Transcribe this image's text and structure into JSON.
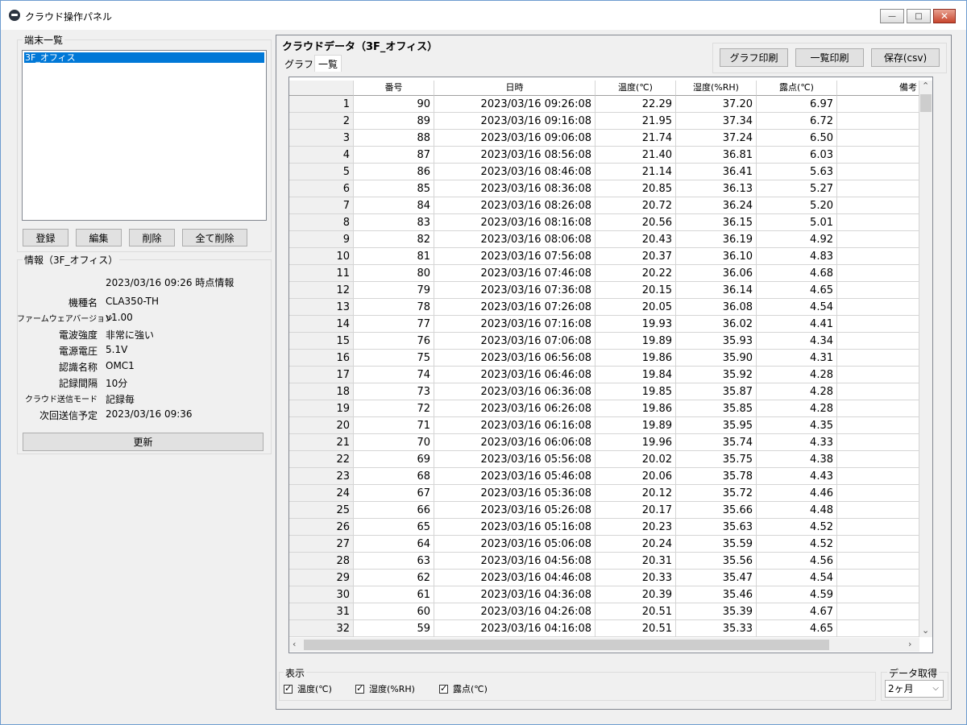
{
  "window": {
    "title": "クラウド操作パネル",
    "minimize": "—",
    "maximize": "□",
    "close": "✕"
  },
  "devices": {
    "group_label": "端末一覧",
    "items": [
      "3F_オフィス"
    ],
    "selected_index": 0,
    "buttons": {
      "register": "登録",
      "edit": "編集",
      "delete": "削除",
      "delete_all": "全て削除"
    }
  },
  "info": {
    "group_label": "情報（3F_オフィス）",
    "timestamp": "2023/03/16 09:26 時点情報",
    "rows": [
      {
        "label": "機種名",
        "value": "CLA350-TH"
      },
      {
        "label": "ファームウェアバージョン",
        "value": "v1.00"
      },
      {
        "label": "電波強度",
        "value": "非常に強い"
      },
      {
        "label": "電源電圧",
        "value": "5.1V"
      },
      {
        "label": "認識名称",
        "value": "OMC1"
      },
      {
        "label": "記録間隔",
        "value": "10分"
      },
      {
        "label": "クラウド送信モード",
        "value": "記録毎"
      },
      {
        "label": "次回送信予定",
        "value": "2023/03/16 09:36"
      }
    ],
    "refresh_button": "更新"
  },
  "panel": {
    "title": "クラウドデータ（3F_オフィス）",
    "tabs": [
      "グラフ",
      "一覧"
    ],
    "active_tab": 1,
    "buttons": {
      "print_graph": "グラフ印刷",
      "print_list": "一覧印刷",
      "save_csv": "保存(csv)"
    }
  },
  "table": {
    "columns": [
      "",
      "番号",
      "日時",
      "温度(℃)",
      "湿度(%RH)",
      "露点(℃)",
      "備考"
    ],
    "rows": [
      [
        "1",
        "90",
        "2023/03/16 09:26:08",
        "22.29",
        "37.20",
        "6.97",
        ""
      ],
      [
        "2",
        "89",
        "2023/03/16 09:16:08",
        "21.95",
        "37.34",
        "6.72",
        ""
      ],
      [
        "3",
        "88",
        "2023/03/16 09:06:08",
        "21.74",
        "37.24",
        "6.50",
        ""
      ],
      [
        "4",
        "87",
        "2023/03/16 08:56:08",
        "21.40",
        "36.81",
        "6.03",
        ""
      ],
      [
        "5",
        "86",
        "2023/03/16 08:46:08",
        "21.14",
        "36.41",
        "5.63",
        ""
      ],
      [
        "6",
        "85",
        "2023/03/16 08:36:08",
        "20.85",
        "36.13",
        "5.27",
        ""
      ],
      [
        "7",
        "84",
        "2023/03/16 08:26:08",
        "20.72",
        "36.24",
        "5.20",
        ""
      ],
      [
        "8",
        "83",
        "2023/03/16 08:16:08",
        "20.56",
        "36.15",
        "5.01",
        ""
      ],
      [
        "9",
        "82",
        "2023/03/16 08:06:08",
        "20.43",
        "36.19",
        "4.92",
        ""
      ],
      [
        "10",
        "81",
        "2023/03/16 07:56:08",
        "20.37",
        "36.10",
        "4.83",
        ""
      ],
      [
        "11",
        "80",
        "2023/03/16 07:46:08",
        "20.22",
        "36.06",
        "4.68",
        ""
      ],
      [
        "12",
        "79",
        "2023/03/16 07:36:08",
        "20.15",
        "36.14",
        "4.65",
        ""
      ],
      [
        "13",
        "78",
        "2023/03/16 07:26:08",
        "20.05",
        "36.08",
        "4.54",
        ""
      ],
      [
        "14",
        "77",
        "2023/03/16 07:16:08",
        "19.93",
        "36.02",
        "4.41",
        ""
      ],
      [
        "15",
        "76",
        "2023/03/16 07:06:08",
        "19.89",
        "35.93",
        "4.34",
        ""
      ],
      [
        "16",
        "75",
        "2023/03/16 06:56:08",
        "19.86",
        "35.90",
        "4.31",
        ""
      ],
      [
        "17",
        "74",
        "2023/03/16 06:46:08",
        "19.84",
        "35.92",
        "4.28",
        ""
      ],
      [
        "18",
        "73",
        "2023/03/16 06:36:08",
        "19.85",
        "35.87",
        "4.28",
        ""
      ],
      [
        "19",
        "72",
        "2023/03/16 06:26:08",
        "19.86",
        "35.85",
        "4.28",
        ""
      ],
      [
        "20",
        "71",
        "2023/03/16 06:16:08",
        "19.89",
        "35.95",
        "4.35",
        ""
      ],
      [
        "21",
        "70",
        "2023/03/16 06:06:08",
        "19.96",
        "35.74",
        "4.33",
        ""
      ],
      [
        "22",
        "69",
        "2023/03/16 05:56:08",
        "20.02",
        "35.75",
        "4.38",
        ""
      ],
      [
        "23",
        "68",
        "2023/03/16 05:46:08",
        "20.06",
        "35.78",
        "4.43",
        ""
      ],
      [
        "24",
        "67",
        "2023/03/16 05:36:08",
        "20.12",
        "35.72",
        "4.46",
        ""
      ],
      [
        "25",
        "66",
        "2023/03/16 05:26:08",
        "20.17",
        "35.66",
        "4.48",
        ""
      ],
      [
        "26",
        "65",
        "2023/03/16 05:16:08",
        "20.23",
        "35.63",
        "4.52",
        ""
      ],
      [
        "27",
        "64",
        "2023/03/16 05:06:08",
        "20.24",
        "35.59",
        "4.52",
        ""
      ],
      [
        "28",
        "63",
        "2023/03/16 04:56:08",
        "20.31",
        "35.56",
        "4.56",
        ""
      ],
      [
        "29",
        "62",
        "2023/03/16 04:46:08",
        "20.33",
        "35.47",
        "4.54",
        ""
      ],
      [
        "30",
        "61",
        "2023/03/16 04:36:08",
        "20.39",
        "35.46",
        "4.59",
        ""
      ],
      [
        "31",
        "60",
        "2023/03/16 04:26:08",
        "20.51",
        "35.39",
        "4.67",
        ""
      ],
      [
        "32",
        "59",
        "2023/03/16 04:16:08",
        "20.51",
        "35.33",
        "4.65",
        ""
      ]
    ]
  },
  "display": {
    "group_label": "表示",
    "checkboxes": [
      {
        "label": "温度(℃)",
        "checked": true
      },
      {
        "label": "湿度(%RH)",
        "checked": true
      },
      {
        "label": "露点(℃)",
        "checked": true
      }
    ]
  },
  "fetch": {
    "group_label": "データ取得",
    "selected": "2ヶ月"
  },
  "colors": {
    "selection": "#0078d7",
    "window_bg": "#f0f0f0",
    "window_border": "#6d9ccf"
  }
}
